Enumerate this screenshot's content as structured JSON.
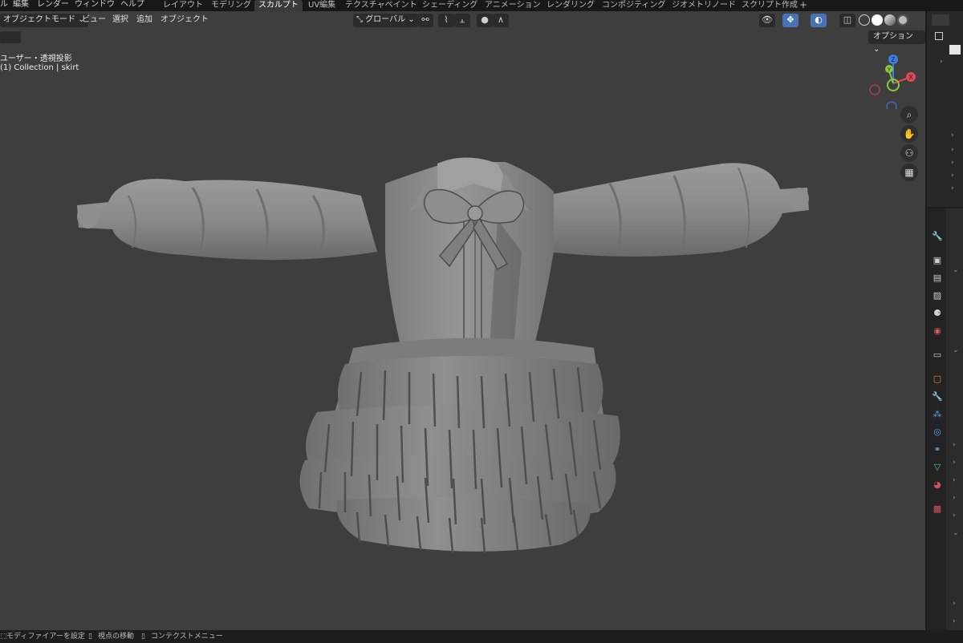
{
  "menubar": {
    "file_partial": "ル",
    "items": [
      "編集",
      "レンダー",
      "ウィンドウ",
      "ヘルプ"
    ]
  },
  "workspaces": {
    "tabs": [
      "レイアウト",
      "モデリング",
      "スカルプト",
      "UV編集",
      "テクスチャペイント",
      "シェーディング",
      "アニメーション",
      "レンダリング",
      "コンポジティング",
      "ジオメトリノード",
      "スクリプト作成"
    ],
    "active": "スカルプト",
    "add": "+"
  },
  "viewport_header": {
    "mode": "オブジェクトモード",
    "menus": [
      "ビュー",
      "選択",
      "追加",
      "オブジェクト"
    ],
    "transform_orientation": "グローバル",
    "options": "オプション"
  },
  "viewport_info": {
    "view": "ユーザー・透視投影",
    "collection": "(1) Collection | skirt"
  },
  "gizmo": {
    "x": "X",
    "y": "Y",
    "z": "Z",
    "colors": {
      "x": "#e04a55",
      "y": "#8cc63f",
      "z": "#3a7ee6"
    }
  },
  "statusbar": {
    "items": [
      "モディファイアーを設定",
      "視点の移動",
      "コンテクストメニュー"
    ]
  },
  "colors": {
    "viewport_bg": "#3e3e3e",
    "accent": "#4772b3",
    "mesh": "#8a8a8a"
  }
}
